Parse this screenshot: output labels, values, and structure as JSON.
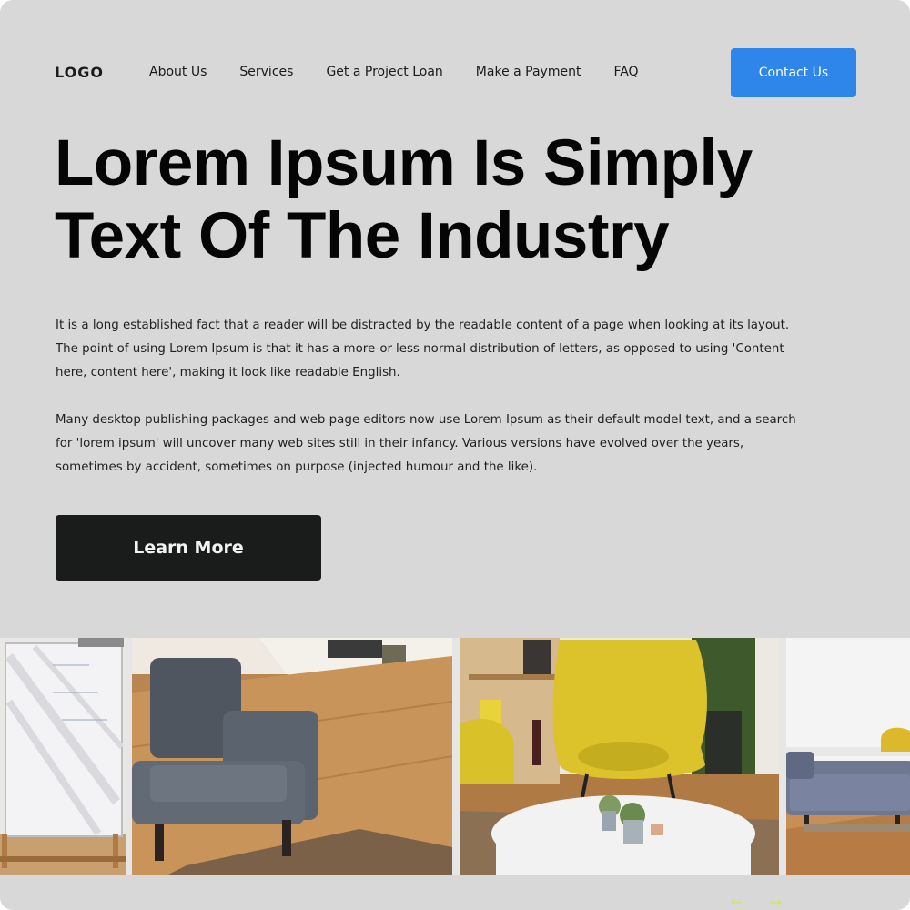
{
  "header": {
    "logo": "LOGO",
    "nav": [
      {
        "label": "About Us"
      },
      {
        "label": "Services"
      },
      {
        "label": "Get a Project Loan"
      },
      {
        "label": "Make a Payment"
      },
      {
        "label": "FAQ"
      }
    ],
    "cta_label": "Contact Us"
  },
  "hero": {
    "title": "Lorem Ipsum Is Simply Text Of The Industry",
    "paragraphs": [
      "It is a long established fact that a reader will be distracted by the readable content of a page when looking at its layout. The point of using Lorem Ipsum is that it has a more-or-less normal distribution of letters, as opposed to using 'Content here, content here', making it look like readable English.",
      "Many desktop publishing packages and web page editors now use Lorem Ipsum as their default model text, and a search for 'lorem ipsum' will uncover many web sites still in their infancy. Various versions have evolved over the years, sometimes by accident, sometimes on purpose (injected humour and the like)."
    ],
    "button_label": "Learn More"
  },
  "gallery": {
    "images": [
      {
        "icon": "whiteboard-photo"
      },
      {
        "icon": "gray-armchair-photo"
      },
      {
        "icon": "yellow-chair-photo"
      },
      {
        "icon": "gray-sofa-photo"
      }
    ],
    "arrows": {
      "prev": "←",
      "next": "→"
    }
  },
  "colors": {
    "page_bg": "#d8d8d8",
    "primary_button": "#2f86ea",
    "dark_button": "#1a1b1b",
    "arrow_accent": "#cfe36a"
  }
}
